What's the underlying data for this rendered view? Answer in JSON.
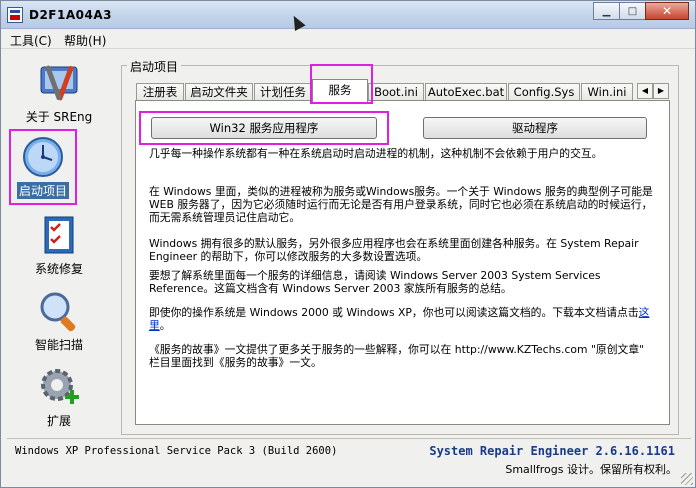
{
  "window": {
    "title": "D2F1A04A3"
  },
  "menubar": {
    "items": [
      "工具(C)",
      "帮助(H)"
    ]
  },
  "nav": {
    "items": [
      {
        "label": "关于 SREng",
        "icon": "tools-icon"
      },
      {
        "label": "启动项目",
        "icon": "clock-icon",
        "selected": true
      },
      {
        "label": "系统修复",
        "icon": "checklist-icon"
      },
      {
        "label": "智能扫描",
        "icon": "magnifier-icon"
      },
      {
        "label": "扩展",
        "icon": "gear-plus-icon"
      }
    ]
  },
  "group": {
    "title": "启动项目"
  },
  "tabs": [
    "注册表",
    "启动文件夹",
    "计划任务",
    "服务",
    "Boot.ini",
    "AutoExec.bat",
    "Config.Sys",
    "Win.ini"
  ],
  "active_tab": "服务",
  "panel": {
    "button_win32": "Win32 服务应用程序",
    "button_driver": "驱动程序",
    "paragraphs": [
      "几乎每一种操作系统都有一种在系统启动时启动进程的机制，这种机制不会依赖于用户的交互。",
      "在 Windows 里面，类似的进程被称为服务或Windows服务。一个关于 Windows 服务的典型例子可能是 WEB 服务器了，因为它必须随时运行而无论是否有用户登录系统，同时它也必须在系统启动的时候运行，而无需系统管理员记住启动它。",
      "Windows 拥有很多的默认服务，另外很多应用程序也会在系统里面创建各种服务。在 System Repair Engineer 的帮助下，你可以修改服务的大多数设置选项。",
      "要想了解系统里面每一个服务的详细信息，请阅读 Windows Server 2003 System Services Reference。这篇文档含有 Windows Server 2003 家族所有服务的总结。",
      "即使你的操作系统是 Windows 2000 或 Windows XP，你也可以阅读这篇文档的。下载本文档请点击",
      "《服务的故事》一文提供了更多关于服务的一些解释，你可以在 http://www.KZTechs.com \"原创文章\" 栏目里面找到《服务的故事》一文。"
    ],
    "link_text": "这里"
  },
  "status": {
    "os_info": "Windows XP Professional Service Pack 3 (Build 2600)",
    "product": "System Repair Engineer 2.6.16.1161",
    "copyright": "Smallfrogs 设计。保留所有权利。"
  },
  "colors": {
    "highlight": "#e020e0",
    "selection": "#3a6ea5",
    "product_text": "#1a3a8a",
    "link": "#0033cc"
  }
}
